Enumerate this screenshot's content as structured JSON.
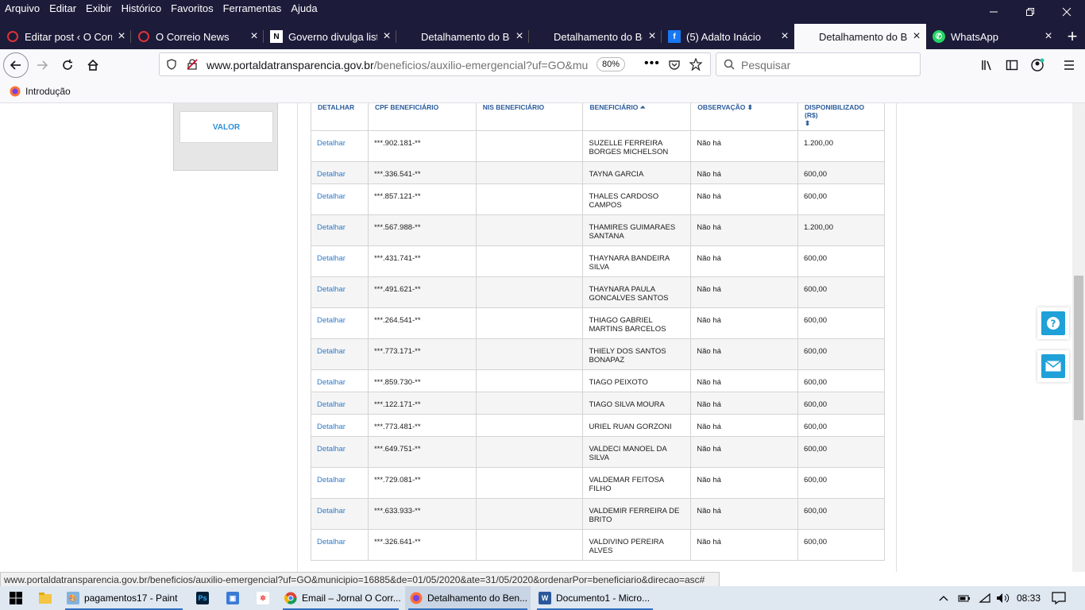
{
  "menubar": {
    "items": [
      "Arquivo",
      "Editar",
      "Exibir",
      "Histórico",
      "Favoritos",
      "Ferramentas",
      "Ajuda"
    ]
  },
  "tabs": [
    {
      "label": "Editar post ‹ O Corre",
      "icon": "wordpress-icon"
    },
    {
      "label": "O Correio News",
      "icon": "wordpress-icon"
    },
    {
      "label": "Governo divulga list",
      "icon": "news-icon"
    },
    {
      "label": "Detalhamento do Be",
      "icon": ""
    },
    {
      "label": "Detalhamento do Be",
      "icon": ""
    },
    {
      "label": "(5) Adalto Inácio",
      "icon": "facebook-icon"
    },
    {
      "label": "Detalhamento do Be",
      "icon": ""
    },
    {
      "label": "WhatsApp",
      "icon": "whatsapp-icon"
    }
  ],
  "navbar": {
    "url_host": "www.portaldatransparencia.gov.br",
    "url_path": "/beneficios/auxilio-emergencial?uf=GO&mun",
    "zoom": "80%",
    "search_placeholder": "Pesquisar"
  },
  "bookmarks": [
    {
      "label": "Introdução"
    }
  ],
  "filter": {
    "valor_label": "VALOR"
  },
  "table": {
    "headers": {
      "detalhar": "DETALHAR",
      "cpf": "CPF BENEFICIÁRIO",
      "nis": "NIS BENEFICIÁRIO",
      "beneficiario": "BENEFICIÁRIO ⏶",
      "observacao": "OBSERVAÇÃO ⬍",
      "disponibilizado": "DISPONIBILIZADO (R$)",
      "disponibilizado_sort": "⬍"
    },
    "rows": [
      {
        "detalhar": "Detalhar",
        "cpf": "***.902.181-**",
        "nis": "",
        "beneficiario": "SUZELLE FERREIRA BORGES MICHELSON",
        "observacao": "Não há",
        "valor": "1.200,00"
      },
      {
        "detalhar": "Detalhar",
        "cpf": "***.336.541-**",
        "nis": "",
        "beneficiario": "TAYNA GARCIA",
        "observacao": "Não há",
        "valor": "600,00"
      },
      {
        "detalhar": "Detalhar",
        "cpf": "***.857.121-**",
        "nis": "",
        "beneficiario": "THALES CARDOSO CAMPOS",
        "observacao": "Não há",
        "valor": "600,00"
      },
      {
        "detalhar": "Detalhar",
        "cpf": "***.567.988-**",
        "nis": "",
        "beneficiario": "THAMIRES GUIMARAES SANTANA",
        "observacao": "Não há",
        "valor": "1.200,00"
      },
      {
        "detalhar": "Detalhar",
        "cpf": "***.431.741-**",
        "nis": "",
        "beneficiario": "THAYNARA BANDEIRA SILVA",
        "observacao": "Não há",
        "valor": "600,00"
      },
      {
        "detalhar": "Detalhar",
        "cpf": "***.491.621-**",
        "nis": "",
        "beneficiario": "THAYNARA PAULA GONCALVES SANTOS",
        "observacao": "Não há",
        "valor": "600,00"
      },
      {
        "detalhar": "Detalhar",
        "cpf": "***.264.541-**",
        "nis": "",
        "beneficiario": "THIAGO GABRIEL MARTINS BARCELOS",
        "observacao": "Não há",
        "valor": "600,00"
      },
      {
        "detalhar": "Detalhar",
        "cpf": "***.773.171-**",
        "nis": "",
        "beneficiario": "THIELY DOS SANTOS BONAPAZ",
        "observacao": "Não há",
        "valor": "600,00"
      },
      {
        "detalhar": "Detalhar",
        "cpf": "***.859.730-**",
        "nis": "",
        "beneficiario": "TIAGO PEIXOTO",
        "observacao": "Não há",
        "valor": "600,00"
      },
      {
        "detalhar": "Detalhar",
        "cpf": "***.122.171-**",
        "nis": "",
        "beneficiario": "TIAGO SILVA MOURA",
        "observacao": "Não há",
        "valor": "600,00"
      },
      {
        "detalhar": "Detalhar",
        "cpf": "***.773.481-**",
        "nis": "",
        "beneficiario": "URIEL RUAN GORZONI",
        "observacao": "Não há",
        "valor": "600,00"
      },
      {
        "detalhar": "Detalhar",
        "cpf": "***.649.751-**",
        "nis": "",
        "beneficiario": "VALDECI MANOEL DA SILVA",
        "observacao": "Não há",
        "valor": "600,00"
      },
      {
        "detalhar": "Detalhar",
        "cpf": "***.729.081-**",
        "nis": "",
        "beneficiario": "VALDEMAR FEITOSA FILHO",
        "observacao": "Não há",
        "valor": "600,00"
      },
      {
        "detalhar": "Detalhar",
        "cpf": "***.633.933-**",
        "nis": "",
        "beneficiario": "VALDEMIR FERREIRA DE BRITO",
        "observacao": "Não há",
        "valor": "600,00"
      },
      {
        "detalhar": "Detalhar",
        "cpf": "***.326.641-**",
        "nis": "",
        "beneficiario": "VALDIVINO PEREIRA ALVES",
        "observacao": "Não há",
        "valor": "600,00"
      }
    ]
  },
  "statusbar": {
    "text": "www.portaldatransparencia.gov.br/beneficios/auxilio-emergencial?uf=GO&municipio=16885&de=01/05/2020&ate=31/05/2020&ordenarPor=beneficiario&direcao=asc#"
  },
  "taskbar": {
    "items": [
      {
        "label": "pagamentos17 - Paint",
        "icon": "paint-icon"
      },
      {
        "label": "",
        "icon": "photoshop-icon"
      },
      {
        "label": "",
        "icon": "gallery-icon"
      },
      {
        "label": "",
        "icon": "pinwheel-icon"
      },
      {
        "label": "Email – Jornal O Corr...",
        "icon": "chrome-icon"
      },
      {
        "label": "Detalhamento do Ben...",
        "icon": "firefox-icon"
      },
      {
        "label": "Documento1 - Micro...",
        "icon": "word-icon"
      }
    ],
    "clock": "08:33"
  },
  "colors": {
    "titlebar": "#1c1b3a",
    "link": "#2f79c8",
    "header": "#2a5b9b",
    "accent": "#1fa0d8"
  }
}
